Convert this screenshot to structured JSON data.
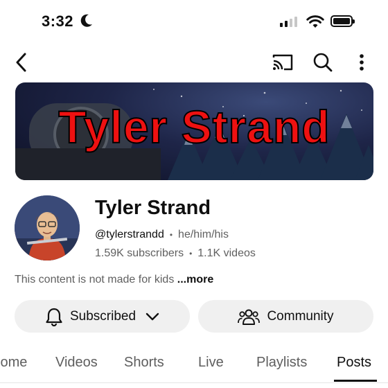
{
  "status": {
    "time": "3:32"
  },
  "banner": {
    "title": "Tyler Strand"
  },
  "channel": {
    "name": "Tyler Strand",
    "handle": "@tylerstrandd",
    "pronouns": "he/him/his",
    "subscribers": "1.59K subscribers",
    "videos": "1.1K videos"
  },
  "description": {
    "text": "This content is not made for kids ",
    "more": "...more"
  },
  "actions": {
    "subscribed": "Subscribed",
    "community": "Community"
  },
  "tabs": [
    {
      "label": "Home"
    },
    {
      "label": "Videos"
    },
    {
      "label": "Shorts"
    },
    {
      "label": "Live"
    },
    {
      "label": "Playlists"
    },
    {
      "label": "Posts"
    }
  ],
  "active_tab": "Posts",
  "colors": {
    "banner_text": "#ee1111",
    "pill_bg": "#f0f0f0"
  }
}
